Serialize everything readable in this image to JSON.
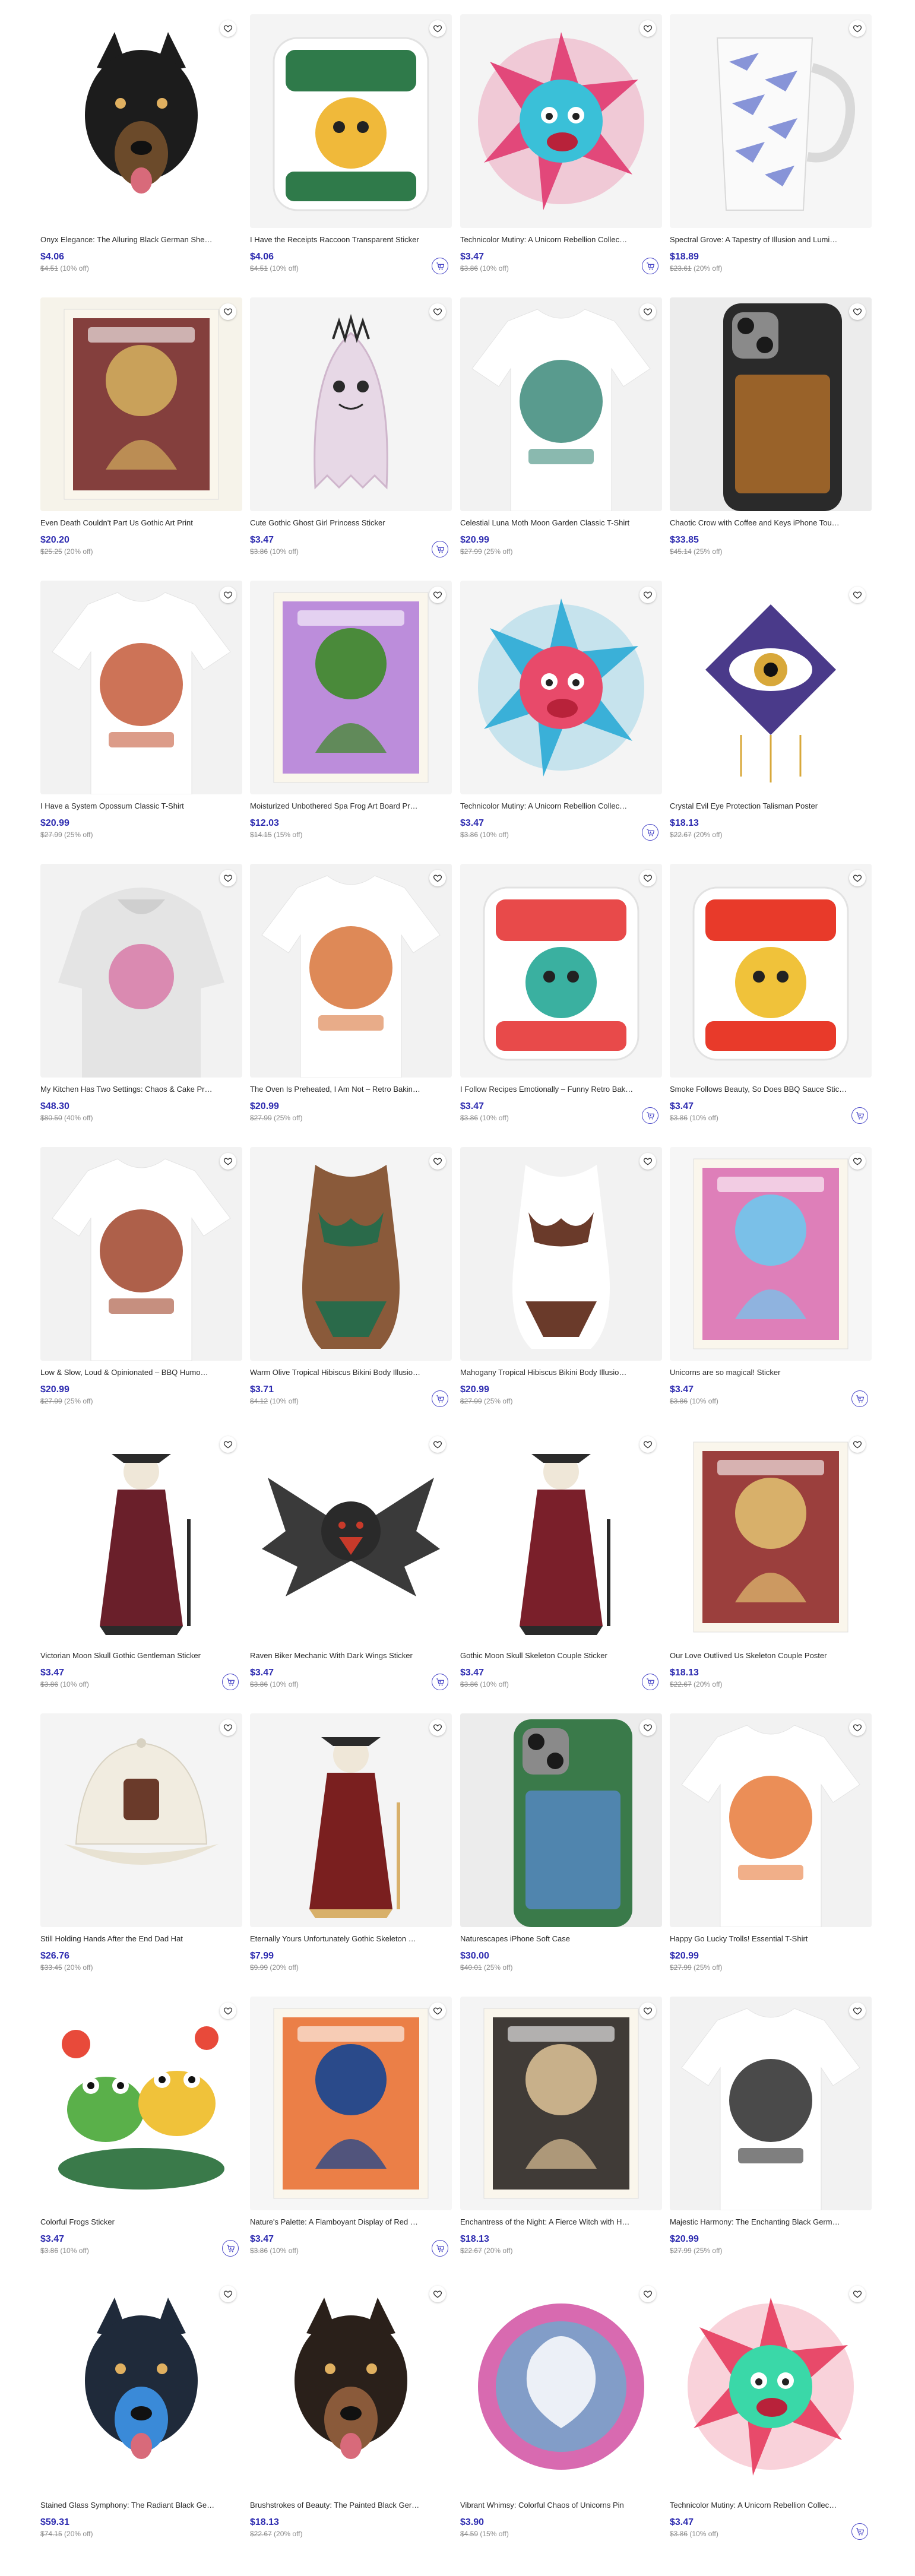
{
  "colors": {
    "price": "#2d2bb0",
    "cart_icon": "#4a48c8",
    "muted": "#8a8a8a"
  },
  "products": [
    {
      "title": "Onyx Elegance: The Alluring Black German She…",
      "price": "$4.06",
      "original": "$4.51",
      "discount": "(10% off)",
      "image": "black-german-shepherd",
      "cart": false
    },
    {
      "title": "I Have the Receipts Raccoon Transparent Sticker",
      "price": "$4.06",
      "original": "$4.51",
      "discount": "(10% off)",
      "image": "raccoon-receipts-sticker",
      "cart": true
    },
    {
      "title": "Technicolor Mutiny: A Unicorn Rebellion Collec…",
      "price": "$3.47",
      "original": "$3.86",
      "discount": "(10% off)",
      "image": "unicorn-rebellion-sticker",
      "cart": true
    },
    {
      "title": "Spectral Grove: A Tapestry of Illusion and Lumi…",
      "price": "$18.89",
      "original": "$23.61",
      "discount": "(20% off)",
      "image": "patterned-mug",
      "cart": false
    },
    {
      "title": "Even Death Couldn't Part Us Gothic Art Print",
      "price": "$20.20",
      "original": "$25.25",
      "discount": "(20% off)",
      "image": "gothic-couple-print",
      "cart": false
    },
    {
      "title": "Cute Gothic Ghost Girl Princess Sticker",
      "price": "$3.47",
      "original": "$3.86",
      "discount": "(10% off)",
      "image": "ghost-girl-sticker",
      "cart": true
    },
    {
      "title": "Celestial Luna Moth Moon Garden Classic T-Shirt",
      "price": "$20.99",
      "original": "$27.99",
      "discount": "(25% off)",
      "image": "luna-moth-tshirt",
      "cart": false
    },
    {
      "title": "Chaotic Crow with Coffee and Keys iPhone Tou…",
      "price": "$33.85",
      "original": "$45.14",
      "discount": "(25% off)",
      "image": "crow-phone-case",
      "cart": false
    },
    {
      "title": "I Have a System Opossum Classic T-Shirt",
      "price": "$20.99",
      "original": "$27.99",
      "discount": "(25% off)",
      "image": "opossum-tshirt",
      "cart": false
    },
    {
      "title": "Moisturized Unbothered Spa Frog Art Board Pr…",
      "price": "$12.03",
      "original": "$14.15",
      "discount": "(15% off)",
      "image": "spa-frog-print",
      "cart": false
    },
    {
      "title": "Technicolor Mutiny: A Unicorn Rebellion Collec…",
      "price": "$3.47",
      "original": "$3.86",
      "discount": "(10% off)",
      "image": "unicorn-rebellion-sticker-2",
      "cart": true
    },
    {
      "title": "Crystal Evil Eye Protection Talisman Poster",
      "price": "$18.13",
      "original": "$22.67",
      "discount": "(20% off)",
      "image": "evil-eye-poster",
      "cart": false
    },
    {
      "title": "My Kitchen Has Two Settings: Chaos & Cake Pr…",
      "price": "$48.30",
      "original": "$80.50",
      "discount": "(40% off)",
      "image": "kitchen-hoodie",
      "cart": false
    },
    {
      "title": "The Oven Is Preheated, I Am Not – Retro Bakin…",
      "price": "$20.99",
      "original": "$27.99",
      "discount": "(25% off)",
      "image": "oven-tshirt",
      "cart": false
    },
    {
      "title": "I Follow Recipes Emotionally – Funny Retro Bak…",
      "price": "$3.47",
      "original": "$3.86",
      "discount": "(10% off)",
      "image": "recipes-sticker",
      "cart": true
    },
    {
      "title": "Smoke Follows Beauty, So Does BBQ Sauce Stic…",
      "price": "$3.47",
      "original": "$3.86",
      "discount": "(10% off)",
      "image": "bbq-sticker",
      "cart": true
    },
    {
      "title": "Low & Slow, Loud & Opinionated – BBQ Humo…",
      "price": "$20.99",
      "original": "$27.99",
      "discount": "(25% off)",
      "image": "bbq-tshirt",
      "cart": false
    },
    {
      "title": "Warm Olive Tropical Hibiscus Bikini Body Illusio…",
      "price": "$3.71",
      "original": "$4.12",
      "discount": "(10% off)",
      "image": "bikini-sticker",
      "cart": true
    },
    {
      "title": "Mahogany Tropical Hibiscus Bikini Body Illusio…",
      "price": "$20.99",
      "original": "$27.99",
      "discount": "(25% off)",
      "image": "bikini-tshirt",
      "cart": false
    },
    {
      "title": "Unicorns are so magical! Sticker",
      "price": "$3.47",
      "original": "$3.86",
      "discount": "(10% off)",
      "image": "unicorns-sticker",
      "cart": true
    },
    {
      "title": "Victorian Moon Skull Gothic Gentleman Sticker",
      "price": "$3.47",
      "original": "$3.86",
      "discount": "(10% off)",
      "image": "victorian-skull-sticker",
      "cart": true
    },
    {
      "title": "Raven Biker Mechanic With Dark Wings Sticker",
      "price": "$3.47",
      "original": "$3.86",
      "discount": "(10% off)",
      "image": "raven-biker-sticker",
      "cart": true
    },
    {
      "title": "Gothic Moon Skull Skeleton Couple Sticker",
      "price": "$3.47",
      "original": "$3.86",
      "discount": "(10% off)",
      "image": "skeleton-couple-sticker",
      "cart": true
    },
    {
      "title": "Our Love Outlived Us Skeleton Couple Poster",
      "price": "$18.13",
      "original": "$22.67",
      "discount": "(20% off)",
      "image": "outlived-poster",
      "cart": false
    },
    {
      "title": "Still Holding Hands After the End Dad Hat",
      "price": "$26.76",
      "original": "$33.45",
      "discount": "(20% off)",
      "image": "dad-hat",
      "cart": false
    },
    {
      "title": "Eternally Yours Unfortunately Gothic Skeleton …",
      "price": "$7.99",
      "original": "$9.99",
      "discount": "(20% off)",
      "image": "eternally-yours-sticker",
      "cart": false
    },
    {
      "title": "Naturescapes iPhone Soft Case",
      "price": "$30.00",
      "original": "$40.01",
      "discount": "(25% off)",
      "image": "nature-phone-case",
      "cart": false
    },
    {
      "title": "Happy Go Lucky Trolls! Essential T-Shirt",
      "price": "$20.99",
      "original": "$27.99",
      "discount": "(25% off)",
      "image": "trolls-tshirt",
      "cart": false
    },
    {
      "title": "Colorful Frogs Sticker",
      "price": "$3.47",
      "original": "$3.86",
      "discount": "(10% off)",
      "image": "frogs-sticker",
      "cart": true
    },
    {
      "title": "Nature's Palette: A Flamboyant Display of Red …",
      "price": "$3.47",
      "original": "$3.86",
      "discount": "(10% off)",
      "image": "mushroom-sticker",
      "cart": true
    },
    {
      "title": "Enchantress of the Night: A Fierce Witch with H…",
      "price": "$18.13",
      "original": "$22.67",
      "discount": "(20% off)",
      "image": "witch-print",
      "cart": false
    },
    {
      "title": "Majestic Harmony: The Enchanting Black Germ…",
      "price": "$20.99",
      "original": "$27.99",
      "discount": "(25% off)",
      "image": "shepherd-tshirt",
      "cart": false
    },
    {
      "title": "Stained Glass Symphony: The Radiant Black Ge…",
      "price": "$59.31",
      "original": "$74.15",
      "discount": "(20% off)",
      "image": "stained-glass-shepherd",
      "cart": false
    },
    {
      "title": "Brushstrokes of Beauty: The Painted Black Ger…",
      "price": "$18.13",
      "original": "$22.67",
      "discount": "(20% off)",
      "image": "painted-shepherd",
      "cart": false
    },
    {
      "title": "Vibrant Whimsy: Colorful Chaos of Unicorns Pin",
      "price": "$3.90",
      "original": "$4.59",
      "discount": "(15% off)",
      "image": "unicorn-pin",
      "cart": false
    },
    {
      "title": "Technicolor Mutiny: A Unicorn Rebellion Collec…",
      "price": "$3.47",
      "original": "$3.86",
      "discount": "(10% off)",
      "image": "unicorn-rebellion-sticker-3",
      "cart": true
    }
  ]
}
